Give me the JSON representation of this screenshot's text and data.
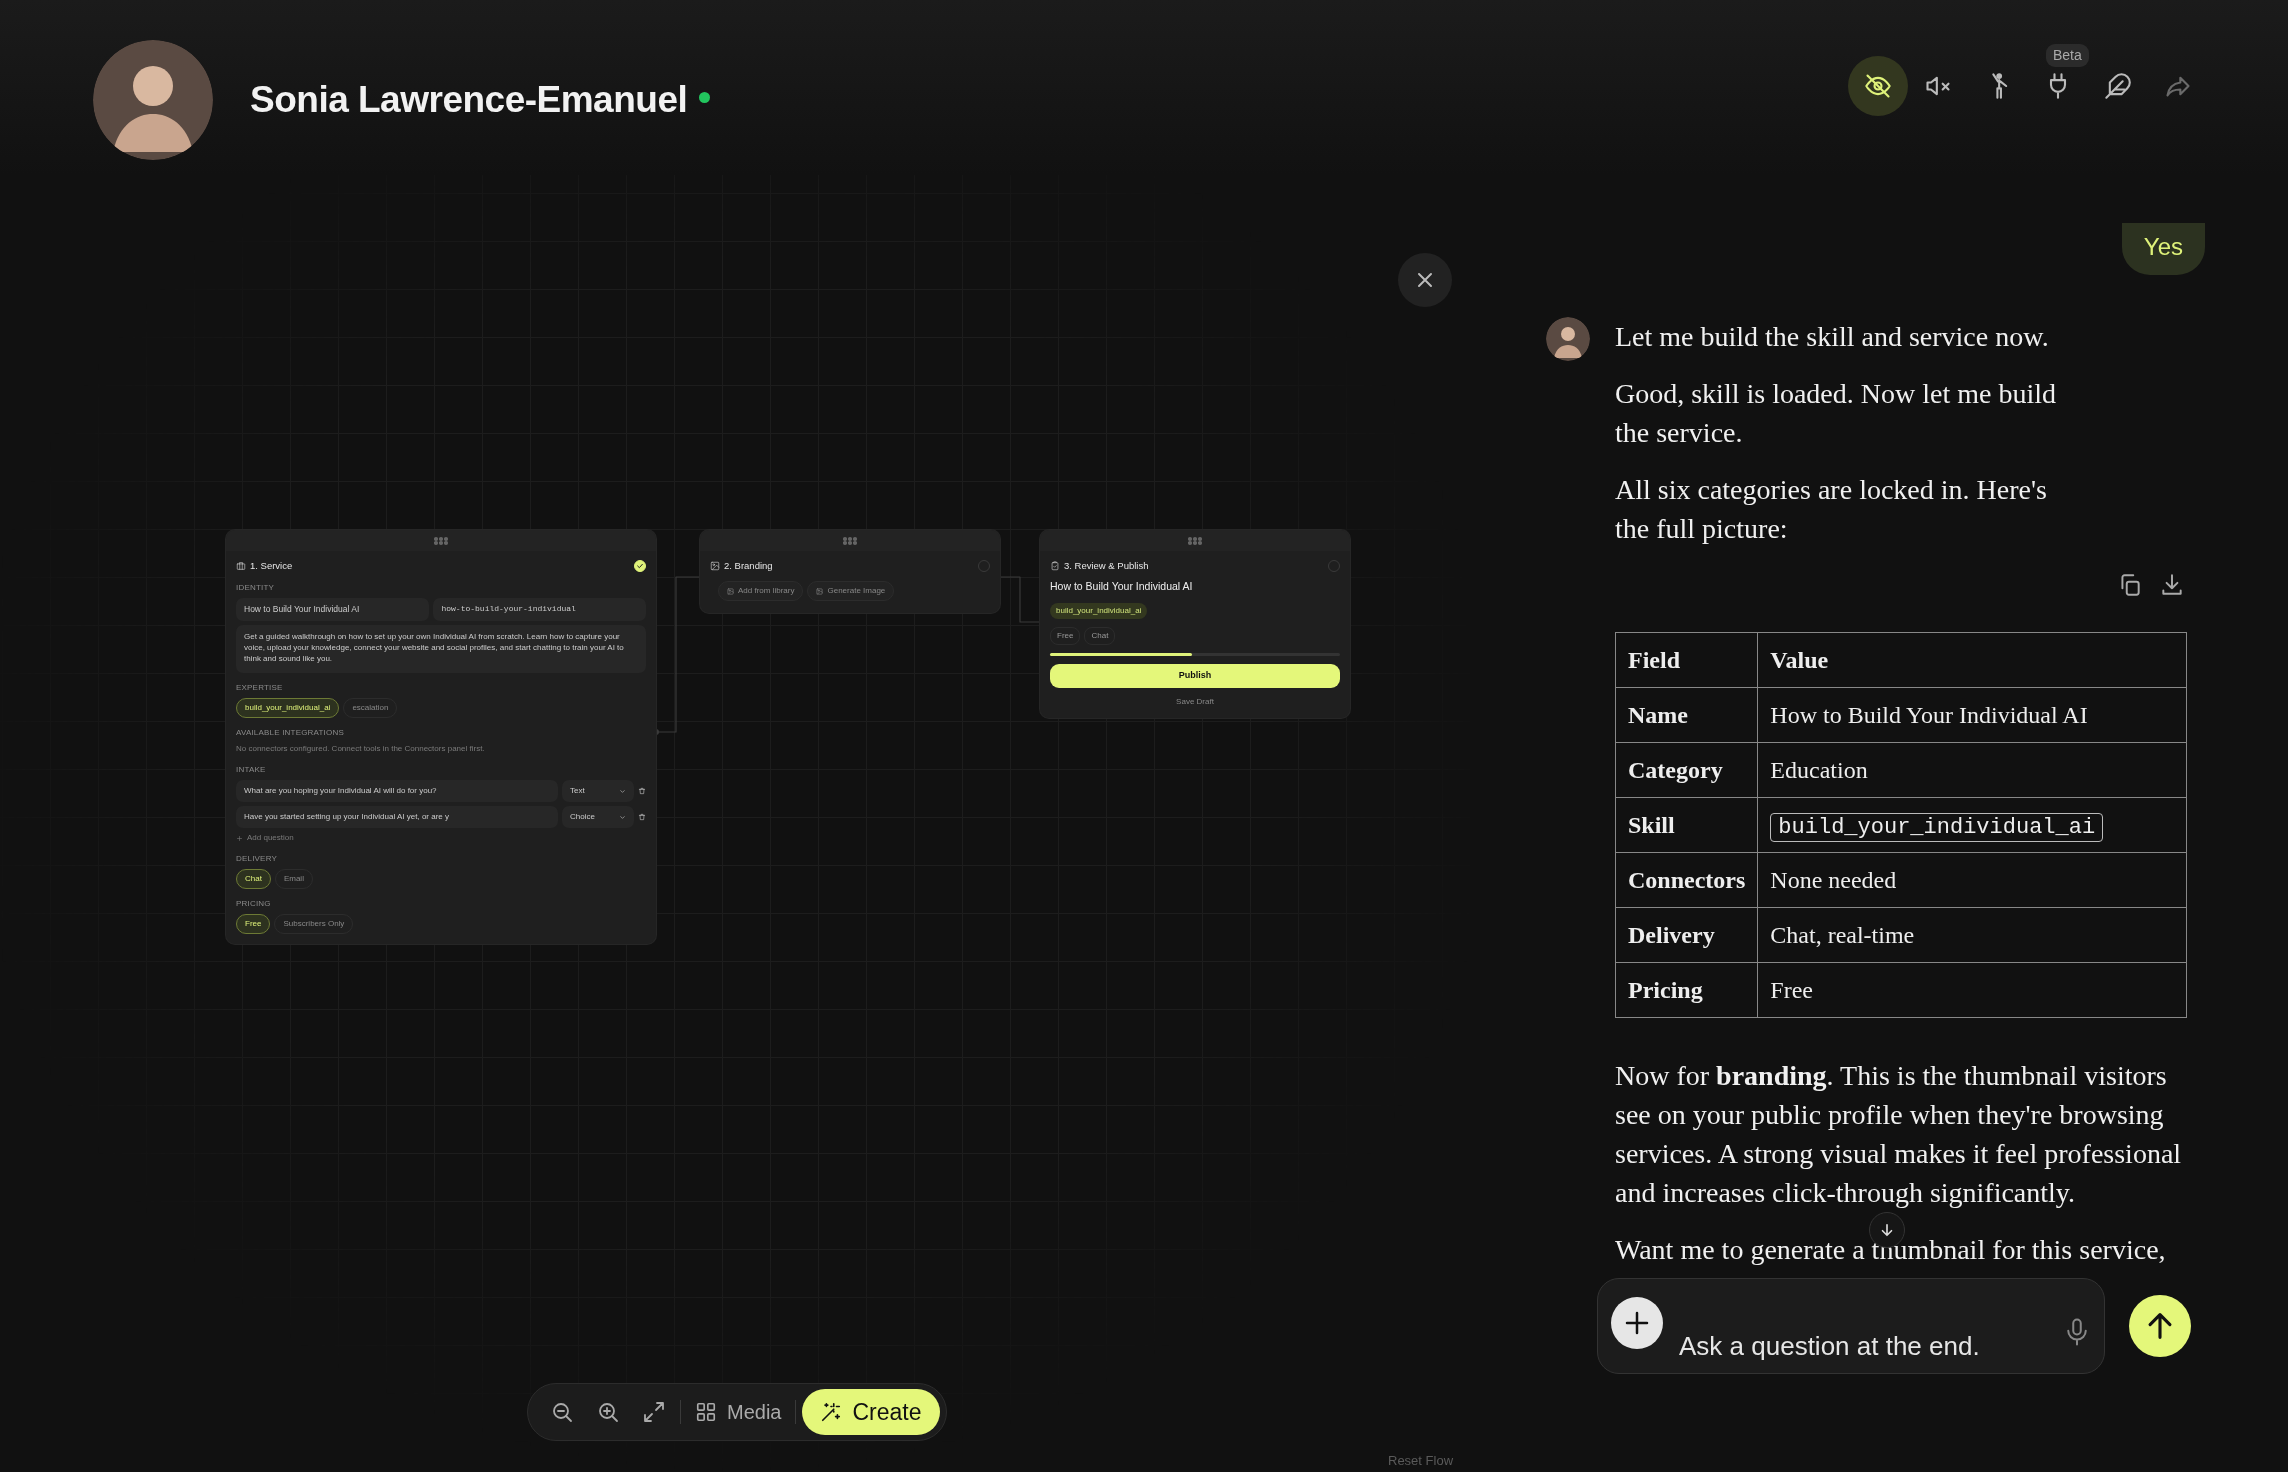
{
  "profile": {
    "name": "Sonia Lawrence-Emanuel",
    "online": true
  },
  "header_actions": [
    {
      "kind": "hide",
      "selected": true,
      "disabled": false
    },
    {
      "kind": "mute",
      "selected": false,
      "disabled": false
    },
    {
      "kind": "person",
      "selected": false,
      "disabled": false
    },
    {
      "kind": "plug",
      "selected": false,
      "disabled": false,
      "badge": "Beta"
    },
    {
      "kind": "feather",
      "selected": false,
      "disabled": false
    },
    {
      "kind": "share",
      "selected": false,
      "disabled": true
    }
  ],
  "flow": {
    "service": {
      "title": "1. Service",
      "done": true,
      "identity_label": "IDENTITY",
      "name_value": "How to Build Your Individual AI",
      "slug_value": "how-to-build-your-individual",
      "description": "Get a guided walkthrough on how to set up your own Individual AI from scratch. Learn how to capture your voice, upload your knowledge, connect your website and social profiles, and start chatting to train your AI to think and sound like you.",
      "expertise_label": "EXPERTISE",
      "expertise": [
        {
          "label": "build_your_individual_ai",
          "selected": true
        },
        {
          "label": "escalation",
          "selected": false
        }
      ],
      "integrations_label": "AVAILABLE INTEGRATIONS",
      "integrations_note": "No connectors configured. Connect tools in the Connectors panel first.",
      "intake_label": "INTAKE",
      "intake": [
        {
          "question": "What are you hoping your Individual AI will do for you?",
          "type": "Text"
        },
        {
          "question": "Have you started setting up your Individual AI yet, or are y",
          "type": "Choice"
        }
      ],
      "add_question": "Add question",
      "delivery_label": "DELIVERY",
      "delivery": [
        {
          "label": "Chat",
          "selected": true
        },
        {
          "label": "Email",
          "selected": false
        }
      ],
      "pricing_label": "PRICING",
      "pricing": [
        {
          "label": "Free",
          "selected": true
        },
        {
          "label": "Subscribers Only",
          "selected": false
        }
      ]
    },
    "branding": {
      "title": "2. Branding",
      "done": false,
      "actions": [
        "Add from library",
        "Generate Image"
      ]
    },
    "review": {
      "title": "3. Review & Publish",
      "done": false,
      "heading": "How to Build Your Individual AI",
      "skill_tag": "build_your_individual_ai",
      "tags": [
        "Free",
        "Chat"
      ],
      "level": 0.49,
      "publish": "Publish",
      "save_draft": "Save Draft"
    }
  },
  "canvas_controls": [
    {
      "kind": "zoom-out"
    },
    {
      "kind": "zoom-in"
    },
    {
      "kind": "fit"
    },
    {
      "kind": "media",
      "label": "Media"
    },
    {
      "kind": "create",
      "label": "Create"
    }
  ],
  "reset_flow": "Reset Flow",
  "chat": {
    "user_message": "Yes",
    "paragraphs_before": [
      "Let me build the skill and service now.",
      "Good, skill is loaded. Now let me build the service.",
      "All six categories are locked in. Here's the full picture:"
    ],
    "table": {
      "columns": [
        "Field",
        "Value"
      ],
      "rows": [
        {
          "field": "Name",
          "value": "How to Build Your Individual AI",
          "kind": "text"
        },
        {
          "field": "Category",
          "value": "Education",
          "kind": "text"
        },
        {
          "field": "Skill",
          "value": "build_your_individual_ai",
          "kind": "code"
        },
        {
          "field": "Connectors",
          "value": "None needed",
          "kind": "text"
        },
        {
          "field": "Delivery",
          "value": "Chat, real-time",
          "kind": "text"
        },
        {
          "field": "Pricing",
          "value": "Free",
          "kind": "text"
        }
      ]
    },
    "paragraphs_after": [
      "Now for **branding**. This is the thumbnail visitors see on your public profile when they're browsing services. A strong visual makes it feel professional and increases click-through significantly.",
      "Want me to generate a thumbnail for this service,"
    ],
    "input": {
      "placeholder": "Ask a question at the end."
    }
  }
}
